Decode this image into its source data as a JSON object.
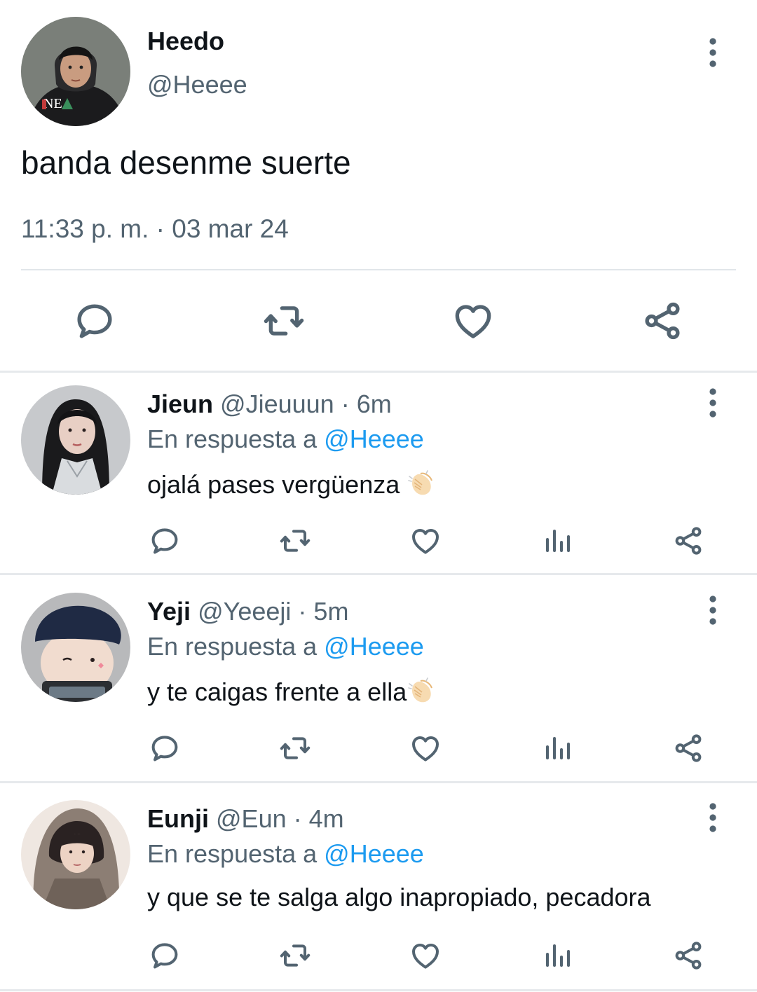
{
  "main_tweet": {
    "name": "Heedo",
    "handle": "@Heeee",
    "text": "banda desenme suerte",
    "timestamp": "11:33 p. m. · 03 mar 24",
    "avatar_shirt_text": "NE",
    "actions": [
      "reply-icon",
      "retweet-icon",
      "like-icon",
      "share-icon"
    ]
  },
  "replies": [
    {
      "name": "Jieun",
      "handle": "@Jieuuun",
      "separator": "·",
      "time": "6m",
      "in_reply_prefix": "En respuesta a",
      "in_reply_handle": "@Heeee",
      "text": "ojalá pases vergüenza",
      "emoji": "clapping-hands-emoji"
    },
    {
      "name": "Yeji",
      "handle": "@Yeeeji",
      "separator": "·",
      "time": "5m",
      "in_reply_prefix": "En respuesta a",
      "in_reply_handle": "@Heeee",
      "text": "y te caigas frente a ella",
      "emoji": "clapping-hands-emoji"
    },
    {
      "name": "Eunji",
      "handle": "@Eun",
      "separator": "·",
      "time": "4m",
      "in_reply_prefix": "En respuesta a",
      "in_reply_handle": "@Heeee",
      "text": "y que se te salga algo inapropiado, pecadora",
      "emoji": ""
    }
  ],
  "colors": {
    "text_primary": "#0f1419",
    "text_secondary": "#536471",
    "mention": "#1d9bf0",
    "divider": "#e6e9ec"
  }
}
